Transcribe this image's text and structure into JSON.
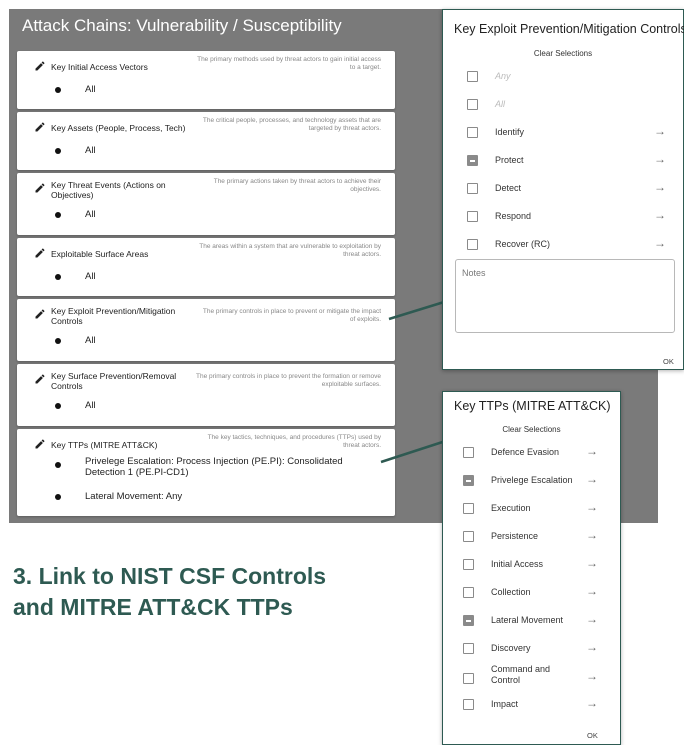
{
  "main": {
    "title": "Attack Chains: Vulnerability / Susceptibility",
    "cards": [
      {
        "title": "Key Initial Access Vectors",
        "description": "The primary methods used by threat actors to gain initial access to a target.",
        "values": [
          "All"
        ]
      },
      {
        "title": "Key Assets (People, Process, Tech)",
        "description": "The critical people, processes, and technology assets that are targeted by threat actors.",
        "values": [
          "All"
        ]
      },
      {
        "title": "Key Threat Events (Actions on Objectives)",
        "description": "The primary actions taken by threat actors to achieve their objectives.",
        "values": [
          "All"
        ]
      },
      {
        "title": "Exploitable Surface Areas",
        "description": "The areas within a system that are vulnerable to exploitation by threat actors.",
        "values": [
          "All"
        ]
      },
      {
        "title": "Key Exploit Prevention/Mitigation Controls",
        "description": "The primary controls in place to prevent or mitigate the impact of exploits.",
        "values": [
          "All"
        ]
      },
      {
        "title": "Key Surface Prevention/Removal Controls",
        "description": "The primary controls in place to prevent the formation or remove exploitable surfaces.",
        "values": [
          "All"
        ]
      },
      {
        "title": "Key TTPs (MITRE ATT&CK)",
        "description": "The key tactics, techniques, and procedures (TTPs) used by threat actors.",
        "values": [
          "Privelege Escalation: Process Injection (PE.PI): Consolidated Detection 1 (PE.PI-CD1)",
          "Lateral Movement: Any"
        ]
      }
    ]
  },
  "controls_dialog": {
    "title": "Key Exploit Prevention/Mitigation Controls",
    "clear_label": "Clear Selections",
    "options": [
      {
        "label": "Any",
        "state": "unchecked",
        "disabled": true
      },
      {
        "label": "All",
        "state": "unchecked",
        "disabled": true
      },
      {
        "label": "Identify",
        "state": "unchecked"
      },
      {
        "label": "Protect",
        "state": "indeterminate"
      },
      {
        "label": "Detect",
        "state": "unchecked"
      },
      {
        "label": "Respond",
        "state": "unchecked"
      },
      {
        "label": "Recover (RC)",
        "state": "unchecked"
      }
    ],
    "notes_label": "Notes",
    "ok_label": "OK"
  },
  "ttps_dialog": {
    "title": "Key TTPs (MITRE ATT&CK)",
    "clear_label": "Clear Selections",
    "options": [
      {
        "label": "Defence Evasion",
        "state": "unchecked"
      },
      {
        "label": "Privelege Escalation",
        "state": "indeterminate"
      },
      {
        "label": "Execution",
        "state": "unchecked"
      },
      {
        "label": "Persistence",
        "state": "unchecked"
      },
      {
        "label": "Initial Access",
        "state": "unchecked"
      },
      {
        "label": "Collection",
        "state": "unchecked"
      },
      {
        "label": "Lateral Movement",
        "state": "indeterminate"
      },
      {
        "label": "Discovery",
        "state": "unchecked"
      },
      {
        "label": "Command and Control",
        "state": "unchecked"
      },
      {
        "label": "Impact",
        "state": "unchecked"
      }
    ],
    "ok_label": "OK"
  },
  "headline": {
    "line1": "3. Link to NIST CSF Controls",
    "line2": "and MITRE ATT&CK TTPs"
  },
  "colors": {
    "panel_bg": "#7a7a7a",
    "accent": "#2e5a52",
    "indeterminate": "#8a8a8a"
  },
  "icons": {
    "card_edit": "pencil-icon",
    "option_next": "arrow-right-icon"
  }
}
